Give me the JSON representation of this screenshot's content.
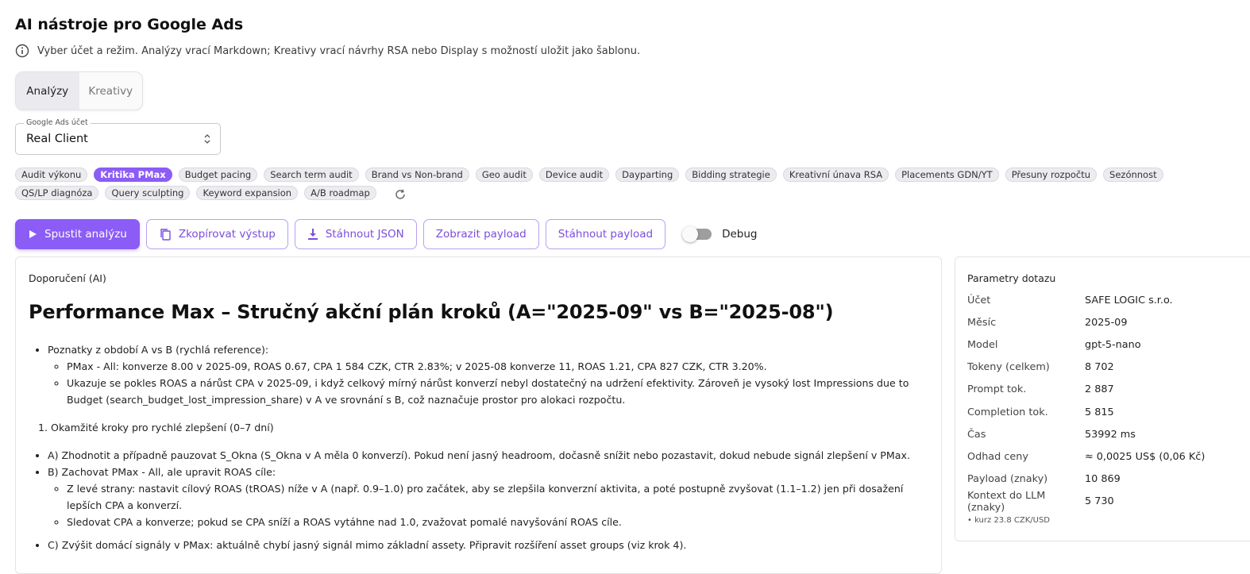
{
  "header": {
    "title": "AI nástroje pro Google Ads",
    "info": "Vyber účet a režim. Analýzy vrací Markdown; Kreativy vrací návrhy RSA nebo Display s možností uložit jako šablonu."
  },
  "modes": [
    {
      "label": "Analýzy",
      "active": true
    },
    {
      "label": "Kreativy",
      "active": false
    }
  ],
  "account": {
    "label": "Google Ads účet",
    "value": "Real Client"
  },
  "chips": [
    {
      "label": "Audit výkonu",
      "active": false
    },
    {
      "label": "Kritika PMax",
      "active": true
    },
    {
      "label": "Budget pacing",
      "active": false
    },
    {
      "label": "Search term audit",
      "active": false
    },
    {
      "label": "Brand vs Non-brand",
      "active": false
    },
    {
      "label": "Geo audit",
      "active": false
    },
    {
      "label": "Device audit",
      "active": false
    },
    {
      "label": "Dayparting",
      "active": false
    },
    {
      "label": "Bidding strategie",
      "active": false
    },
    {
      "label": "Kreativní únava RSA",
      "active": false
    },
    {
      "label": "Placements GDN/YT",
      "active": false
    },
    {
      "label": "Přesuny rozpočtu",
      "active": false
    },
    {
      "label": "Sezónnost",
      "active": false
    },
    {
      "label": "QS/LP diagnóza",
      "active": false
    },
    {
      "label": "Query sculpting",
      "active": false
    },
    {
      "label": "Keyword expansion",
      "active": false
    },
    {
      "label": "A/B roadmap",
      "active": false
    }
  ],
  "actions": {
    "run": "Spustit analýzu",
    "copy": "Zkopírovat výstup",
    "download_json": "Stáhnout JSON",
    "show_payload": "Zobrazit payload",
    "download_payload": "Stáhnout payload",
    "debug": "Debug",
    "debug_on": false
  },
  "report": {
    "card_label": "Doporučení (AI)",
    "title": "Performance Max – Stručný akční plán kroků (A=\"2025-09\" vs B=\"2025-08\")",
    "section1": {
      "heading": "Poznatky z období A vs B (rychlá reference):",
      "items": [
        "PMax - All: konverze 8.00 v 2025-09, ROAS 0.67, CPA 1 584 CZK, CTR 2.83%; v 2025-08 konverze 11, ROAS 1.21, CPA 827 CZK, CTR 3.20%.",
        "Ukazuje se pokles ROAS a nárůst CPA v 2025-09, i když celkový mírný nárůst konverzí nebyl dostatečný na udržení efektivity. Zároveň je vysoký lost Impressions due to Budget (search_budget_lost_impression_share) v A ve srovnání s B, což naznačuje prostor pro alokaci rozpočtu."
      ]
    },
    "section2_heading": "Okamžité kroky pro rychlé zlepšení (0–7 dní)",
    "steps": {
      "a": "A) Zhodnotit a případně pauzovat S_Okna (S_Okna v A měla 0 konverzí). Pokud není jasný headroom, dočasně snížit nebo pozastavit, dokud nebude signál zlepšení v PMax.",
      "b": "B) Zachovat PMax - All, ale upravit ROAS cíle:",
      "b_items": [
        "Z levé strany: nastavit cílový ROAS (tROAS) níže v A (např. 0.9–1.0) pro začátek, aby se zlepšila konverzní aktivita, a poté postupně zvyšovat (1.1–1.2) jen při dosažení lepších CPA a konverzí.",
        "Sledovat CPA a konverze; pokud se CPA sníží a ROAS vytáhne nad 1.0, zvažovat pomalé navyšování ROAS cíle."
      ],
      "c": "C) Zvýšit domácí signály v PMax: aktuálně chybí jasný signál mimo základní assety. Připravit rozšíření asset groups (viz krok 4)."
    }
  },
  "params": {
    "title": "Parametry dotazu",
    "rows": [
      {
        "key": "Účet",
        "value": "SAFE LOGIC s.r.o."
      },
      {
        "key": "Měsíc",
        "value": "2025-09"
      },
      {
        "key": "Model",
        "value": "gpt-5-nano"
      },
      {
        "key": "Tokeny (celkem)",
        "value": "8 702"
      },
      {
        "key": "Prompt tok.",
        "value": "2 887"
      },
      {
        "key": "Completion tok.",
        "value": "5 815"
      },
      {
        "key": "Čas",
        "value": "53992 ms"
      },
      {
        "key": "Odhad ceny",
        "value": "≈ 0,0025 US$ (0,06 Kč)"
      },
      {
        "key": "Payload (znaky)",
        "value": "10 869"
      },
      {
        "key": "Kontext do LLM (znaky)",
        "value": "5 730"
      }
    ],
    "note": "• kurz 23.8 CZK/USD"
  },
  "colors": {
    "accent": "#8b5cf6",
    "accent_text": "#7c4ddb",
    "outline": "#b9a0f0"
  }
}
